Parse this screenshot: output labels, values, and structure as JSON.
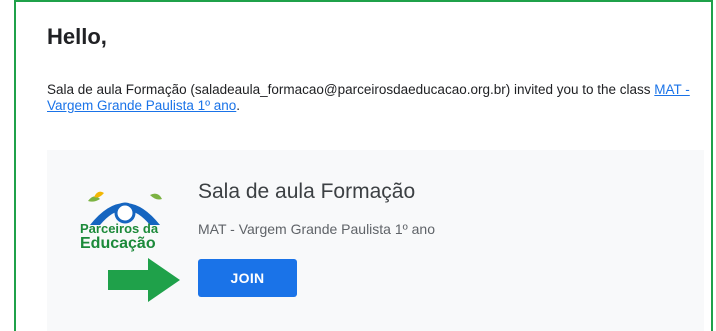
{
  "email": {
    "greeting": "Hello,",
    "intro_prefix": "Sala de aula Formação (saladeaula_formacao@parceirosdaeducacao.org.br) invited you to the class ",
    "class_link_text": "MAT - Vargem Grande Paulista 1º ano",
    "intro_suffix": "."
  },
  "card": {
    "logo_line1": "Parceiros da",
    "logo_line2": "Educação",
    "title": "Sala de aula Formação",
    "subtitle": "MAT - Vargem Grande Paulista 1º ano",
    "join_label": "JOIN"
  },
  "colors": {
    "frame_border": "#1fa14a",
    "link": "#1a73e8",
    "button": "#1a73e8",
    "arrow": "#1fa14a",
    "logo_blue": "#1565c0",
    "logo_green": "#1c8a3a",
    "logo_yellow": "#f2b705"
  },
  "icons": {
    "logo": "parceiros-da-educacao-logo",
    "arrow": "arrow-right-icon"
  }
}
